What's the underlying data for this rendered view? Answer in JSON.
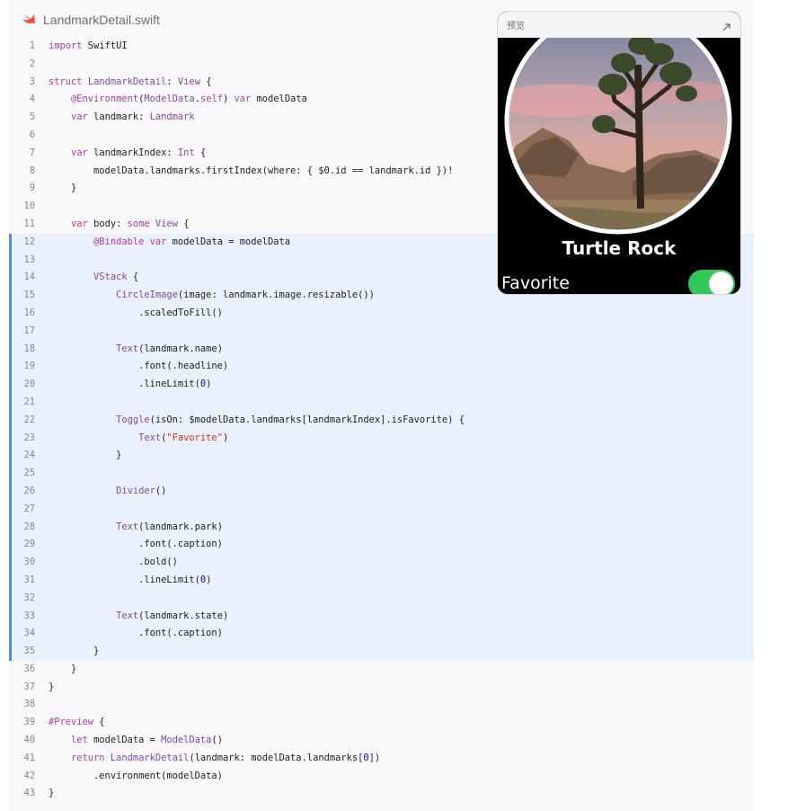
{
  "file": {
    "name": "LandmarkDetail.swift",
    "icon": "swift-icon",
    "accent": "#f05138"
  },
  "preview": {
    "title": "预览",
    "expand_icon": "expand-arrow-icon",
    "landmark_name": "Turtle Rock",
    "favorite_label": "Favorite",
    "toggle_on": true,
    "toggle_color": "#34c759"
  },
  "highlight": {
    "start": 12,
    "end": 35,
    "color": "#eaf1fc",
    "bar_color": "#4a90e2"
  },
  "code_lines": [
    [
      [
        "k",
        "import"
      ],
      [
        "p",
        " SwiftUI"
      ]
    ],
    [],
    [
      [
        "k",
        "struct"
      ],
      [
        "p",
        " "
      ],
      [
        "t",
        "LandmarkDetail"
      ],
      [
        "p",
        ": "
      ],
      [
        "t",
        "View"
      ],
      [
        "p",
        " {"
      ]
    ],
    [
      [
        "p",
        "    "
      ],
      [
        "k",
        "@Environment"
      ],
      [
        "p",
        "("
      ],
      [
        "t",
        "ModelData"
      ],
      [
        "p",
        "."
      ],
      [
        "k",
        "self"
      ],
      [
        "p",
        ") "
      ],
      [
        "k",
        "var"
      ],
      [
        "p",
        " modelData"
      ]
    ],
    [
      [
        "p",
        "    "
      ],
      [
        "k",
        "var"
      ],
      [
        "p",
        " landmark: "
      ],
      [
        "t",
        "Landmark"
      ]
    ],
    [],
    [
      [
        "p",
        "    "
      ],
      [
        "k",
        "var"
      ],
      [
        "p",
        " landmarkIndex: "
      ],
      [
        "t",
        "Int"
      ],
      [
        "p",
        " {"
      ]
    ],
    [
      [
        "p",
        "        modelData.landmarks.firstIndex(where: { $0.id == landmark.id })!"
      ]
    ],
    [
      [
        "p",
        "    }"
      ]
    ],
    [],
    [
      [
        "p",
        "    "
      ],
      [
        "k",
        "var"
      ],
      [
        "p",
        " body: "
      ],
      [
        "k",
        "some"
      ],
      [
        "p",
        " "
      ],
      [
        "t",
        "View"
      ],
      [
        "p",
        " {"
      ]
    ],
    [
      [
        "p",
        "        "
      ],
      [
        "k",
        "@Bindable"
      ],
      [
        "p",
        " "
      ],
      [
        "k",
        "var"
      ],
      [
        "p",
        " modelData = modelData"
      ]
    ],
    [],
    [
      [
        "p",
        "        "
      ],
      [
        "t",
        "VStack"
      ],
      [
        "p",
        " {"
      ]
    ],
    [
      [
        "p",
        "            "
      ],
      [
        "t",
        "CircleImage"
      ],
      [
        "p",
        "(image: landmark.image.resizable())"
      ]
    ],
    [
      [
        "p",
        "                .scaledToFill()"
      ]
    ],
    [],
    [
      [
        "p",
        "            "
      ],
      [
        "t",
        "Text"
      ],
      [
        "p",
        "(landmark.name)"
      ]
    ],
    [
      [
        "p",
        "                .font(.headline)"
      ]
    ],
    [
      [
        "p",
        "                .lineLimit("
      ],
      [
        "n",
        "0"
      ],
      [
        "p",
        ")"
      ]
    ],
    [],
    [
      [
        "p",
        "            "
      ],
      [
        "t",
        "Toggle"
      ],
      [
        "p",
        "(isOn: $modelData.landmarks[landmarkIndex].isFavorite) {"
      ]
    ],
    [
      [
        "p",
        "                "
      ],
      [
        "t",
        "Text"
      ],
      [
        "p",
        "("
      ],
      [
        "s",
        "\"Favorite\""
      ],
      [
        "p",
        ")"
      ]
    ],
    [
      [
        "p",
        "            }"
      ]
    ],
    [],
    [
      [
        "p",
        "            "
      ],
      [
        "t",
        "Divider"
      ],
      [
        "p",
        "()"
      ]
    ],
    [],
    [
      [
        "p",
        "            "
      ],
      [
        "t",
        "Text"
      ],
      [
        "p",
        "(landmark.park)"
      ]
    ],
    [
      [
        "p",
        "                .font(.caption)"
      ]
    ],
    [
      [
        "p",
        "                .bold()"
      ]
    ],
    [
      [
        "p",
        "                .lineLimit("
      ],
      [
        "n",
        "0"
      ],
      [
        "p",
        ")"
      ]
    ],
    [],
    [
      [
        "p",
        "            "
      ],
      [
        "t",
        "Text"
      ],
      [
        "p",
        "(landmark.state)"
      ]
    ],
    [
      [
        "p",
        "                .font(.caption)"
      ]
    ],
    [
      [
        "p",
        "        }"
      ]
    ],
    [
      [
        "p",
        "    }"
      ]
    ],
    [
      [
        "p",
        "}"
      ]
    ],
    [],
    [
      [
        "k",
        "#Preview"
      ],
      [
        "p",
        " {"
      ]
    ],
    [
      [
        "p",
        "    "
      ],
      [
        "k",
        "let"
      ],
      [
        "p",
        " modelData = "
      ],
      [
        "t",
        "ModelData"
      ],
      [
        "p",
        "()"
      ]
    ],
    [
      [
        "p",
        "    "
      ],
      [
        "k",
        "return"
      ],
      [
        "p",
        " "
      ],
      [
        "t",
        "LandmarkDetail"
      ],
      [
        "p",
        "(landmark: modelData.landmarks["
      ],
      [
        "n",
        "0"
      ],
      [
        "p",
        "])"
      ]
    ],
    [
      [
        "p",
        "        .environment(modelData)"
      ]
    ],
    [
      [
        "p",
        "}"
      ]
    ]
  ]
}
